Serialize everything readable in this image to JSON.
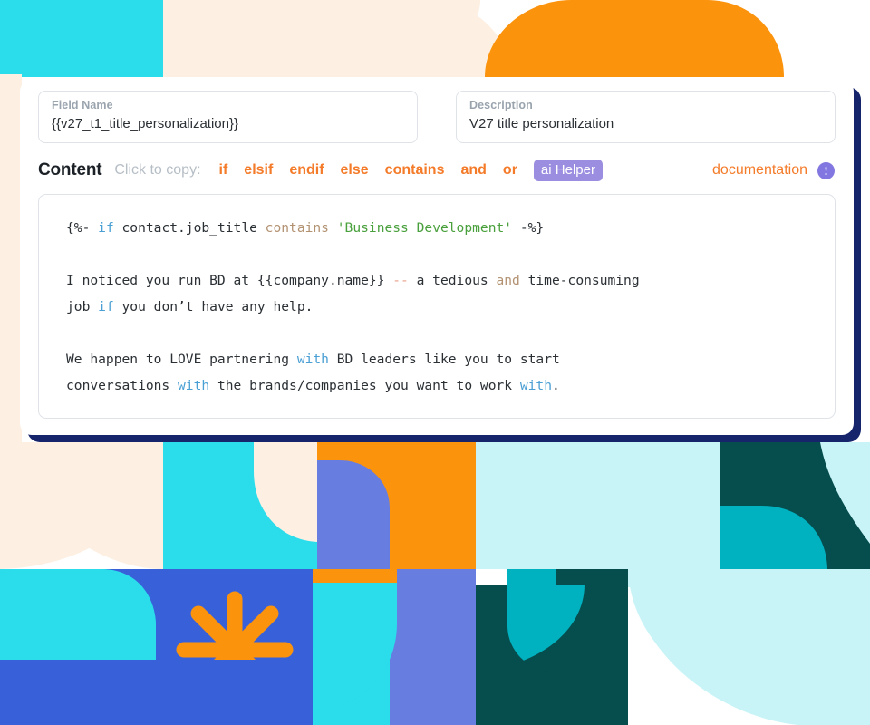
{
  "card": {
    "fields": [
      {
        "label": "Field Name",
        "value": "{{v27_t1_title_personalization}}"
      },
      {
        "label": "Description",
        "value": "V27 title personalization"
      }
    ],
    "toolbar": {
      "title": "Content",
      "hint": "Click to copy:",
      "chips": [
        "if",
        "elsif",
        "endif",
        "else",
        "contains",
        "and",
        "or"
      ],
      "ai_chip": "ai Helper",
      "documentation_label": "documentation",
      "info_icon": "!"
    },
    "code": {
      "lines": [
        [
          {
            "t": "{%- ",
            "c": "plain"
          },
          {
            "t": "if",
            "c": "if"
          },
          {
            "t": " contact.job_title ",
            "c": "plain"
          },
          {
            "t": "contains",
            "c": "tan"
          },
          {
            "t": " ",
            "c": "plain"
          },
          {
            "t": "'Business Development'",
            "c": "str"
          },
          {
            "t": " ",
            "c": "plain"
          },
          {
            "t": "-%}",
            "c": "plain"
          }
        ],
        [],
        [
          {
            "t": "I noticed you run BD at {{company.name}} ",
            "c": "plain"
          },
          {
            "t": "--",
            "c": "dash"
          },
          {
            "t": " a tedious ",
            "c": "plain"
          },
          {
            "t": "and",
            "c": "tan"
          },
          {
            "t": " time-consuming",
            "c": "plain"
          }
        ],
        [
          {
            "t": "job ",
            "c": "plain"
          },
          {
            "t": "if",
            "c": "if"
          },
          {
            "t": " you don’t have any help.",
            "c": "plain"
          }
        ],
        [],
        [
          {
            "t": "We happen to LOVE partnering ",
            "c": "plain"
          },
          {
            "t": "with",
            "c": "if"
          },
          {
            "t": " BD leaders like you to start",
            "c": "plain"
          }
        ],
        [
          {
            "t": "conversations ",
            "c": "plain"
          },
          {
            "t": "with",
            "c": "if"
          },
          {
            "t": " the brands/companies you want to work ",
            "c": "plain"
          },
          {
            "t": "with",
            "c": "if"
          },
          {
            "t": ".",
            "c": "plain"
          }
        ]
      ]
    }
  },
  "colors": {
    "accent_orange": "#f47b29",
    "bright_orange": "#fb930d",
    "cyan": "#2bdceb",
    "light_cyan": "#c9f4f7",
    "teal": "#00b2c0",
    "dark_teal": "#064d4e",
    "royal_blue": "#3861d9",
    "periwinkle": "#677ee0",
    "cream": "#fdf0e2",
    "navy_shadow": "#15246b",
    "purple": "#8277e0"
  },
  "background": {
    "decor_icon": "starburst-icon"
  }
}
